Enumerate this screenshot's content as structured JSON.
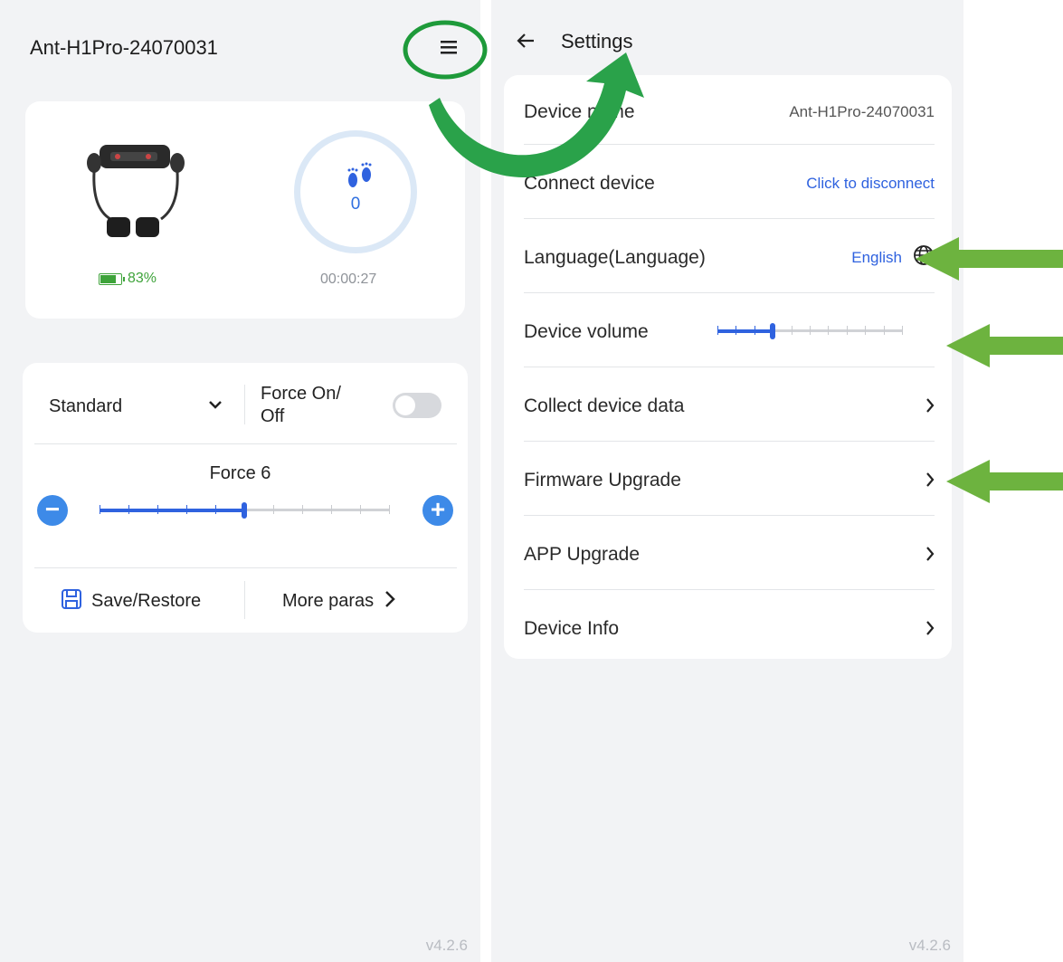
{
  "left": {
    "device_name": "Ant-H1Pro-24070031",
    "menu_icon": "hamburger-menu-icon",
    "battery_percent": "83%",
    "battery_level": 0.83,
    "steps": "0",
    "timer": "00:00:27",
    "mode": "Standard",
    "force_toggle_label": "Force On/ Off",
    "force_toggle_on": false,
    "force_label": "Force 6",
    "force_level": 0.5,
    "save_restore": "Save/Restore",
    "more_paras": "More paras",
    "version": "v4.2.6"
  },
  "right": {
    "title": "Settings",
    "rows": [
      {
        "label": "Device name",
        "value": "Ant-H1Pro-24070031"
      },
      {
        "label": "Connect device",
        "value": "Click to disconnect"
      },
      {
        "label": "Language(Language)",
        "value": "English"
      },
      {
        "label": "Device volume",
        "volume_level": 0.3
      },
      {
        "label": "Collect device data"
      },
      {
        "label": "Firmware Upgrade"
      },
      {
        "label": "APP Upgrade"
      },
      {
        "label": "Device Info"
      }
    ],
    "version": "v4.2.6"
  },
  "colors": {
    "accent_blue": "#2f62df",
    "battery_green": "#3ea33a",
    "annotation_green": "#6db33f",
    "circle_green": "#1e9a3a"
  }
}
